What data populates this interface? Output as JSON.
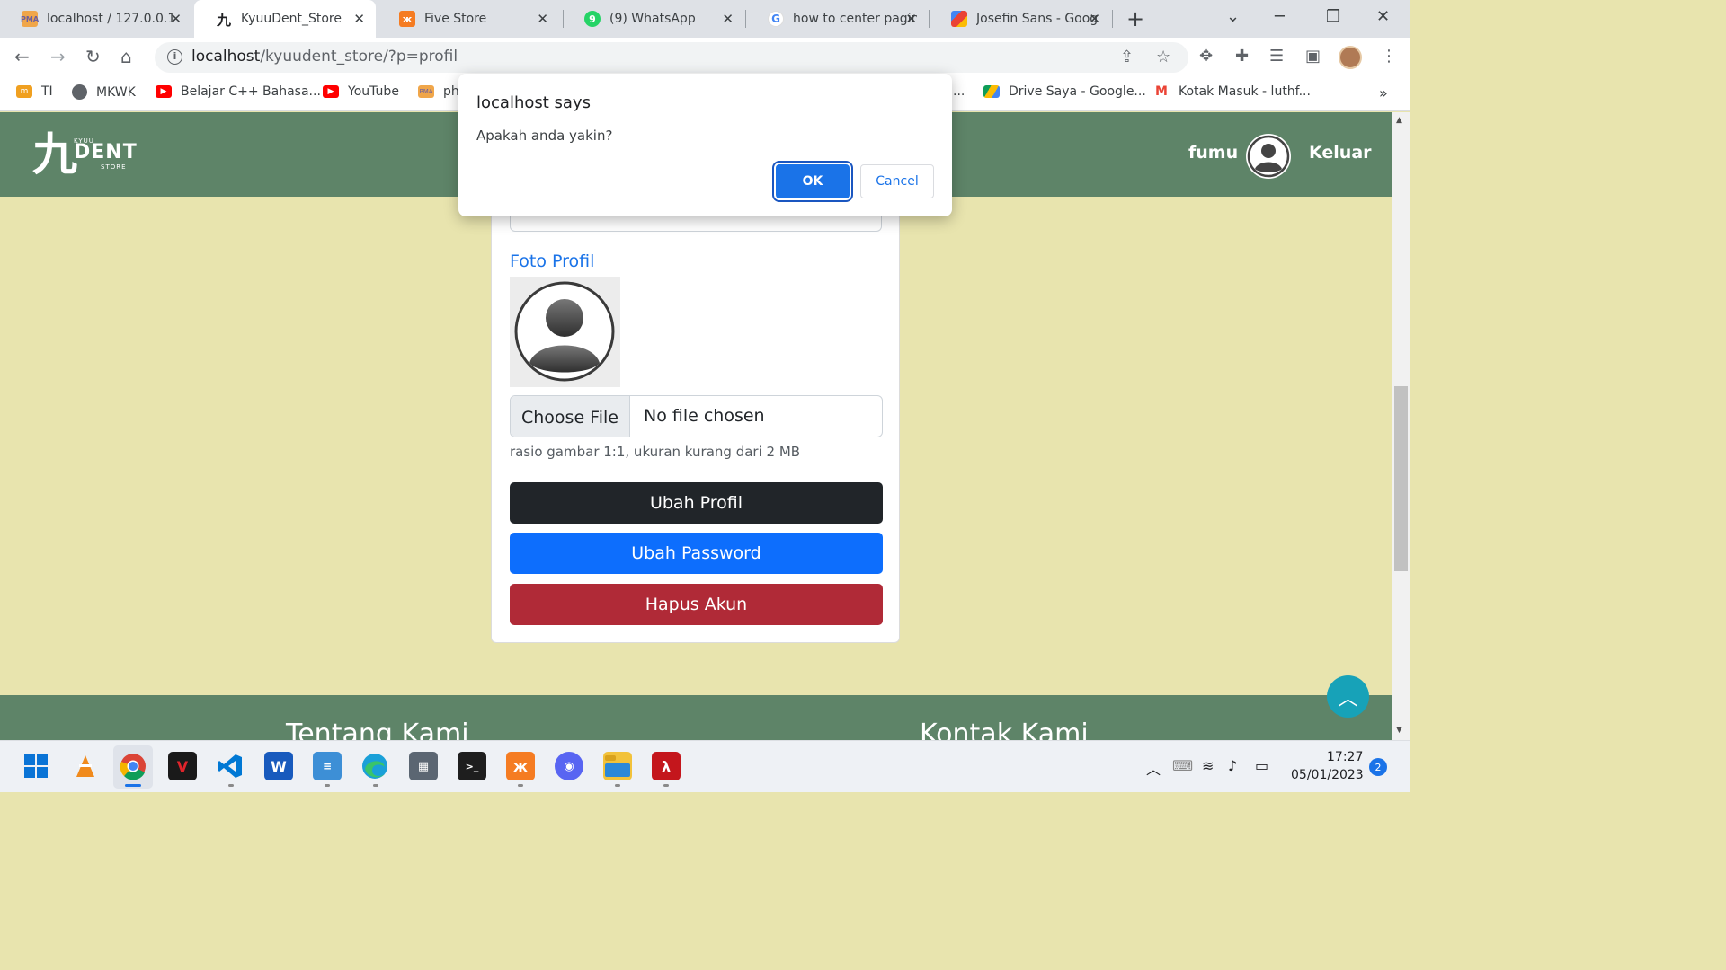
{
  "browser": {
    "tabs": [
      {
        "title": "localhost / 127.0.0.1",
        "icon": "phpmyadmin-icon"
      },
      {
        "title": "KyuuDent_Store",
        "icon": "kyuudent-icon",
        "active": true
      },
      {
        "title": "Five Store",
        "icon": "xampp-icon"
      },
      {
        "title": "(9) WhatsApp",
        "icon": "whatsapp-icon"
      },
      {
        "title": "how to center pagin",
        "icon": "google-icon"
      },
      {
        "title": "Josefin Sans - Goog",
        "icon": "google-fonts-icon"
      }
    ],
    "url_host": "localhost",
    "url_path": "/kyuudent_store/?p=profil",
    "bookmarks": [
      {
        "label": "TI",
        "icon": "bookmark-ti-icon"
      },
      {
        "label": "MKWK",
        "icon": "globe-icon"
      },
      {
        "label": "Belajar C++ Bahasa...",
        "icon": "youtube-icon"
      },
      {
        "label": "YouTube",
        "icon": "youtube-icon"
      },
      {
        "label": "ph",
        "icon": "phpmyadmin-icon"
      },
      {
        "label": "...",
        "icon": ""
      },
      {
        "label": "Drive Saya - Google...",
        "icon": "google-drive-icon"
      },
      {
        "label": "Kotak Masuk - luthf...",
        "icon": "gmail-icon"
      }
    ]
  },
  "site": {
    "logo": {
      "top": "KYUU",
      "main": "DENT",
      "bottom": "STORE",
      "kanji": "九"
    },
    "username": "fumu",
    "logout": "Keluar"
  },
  "profile": {
    "photo_label": "Foto Profil",
    "file_button": "Choose File",
    "file_status": "No file chosen",
    "hint": "rasio gambar 1:1, ukuran kurang dari 2 MB",
    "buttons": {
      "edit_profile": "Ubah Profil",
      "change_password": "Ubah Password",
      "delete_account": "Hapus Akun"
    }
  },
  "footer": {
    "about": "Tentang Kami",
    "contact": "Kontak Kami"
  },
  "dialog": {
    "title": "localhost says",
    "message": "Apakah anda yakin?",
    "ok": "OK",
    "cancel": "Cancel"
  },
  "taskbar": {
    "time": "17:27",
    "date": "05/01/2023",
    "notifications": "2"
  },
  "colors": {
    "header_green": "#5e8468",
    "page_bg": "#e8e4ae",
    "primary_blue": "#0d6efd",
    "danger_red": "#b02a37",
    "dark": "#212529",
    "to_top": "#17a2b8"
  }
}
